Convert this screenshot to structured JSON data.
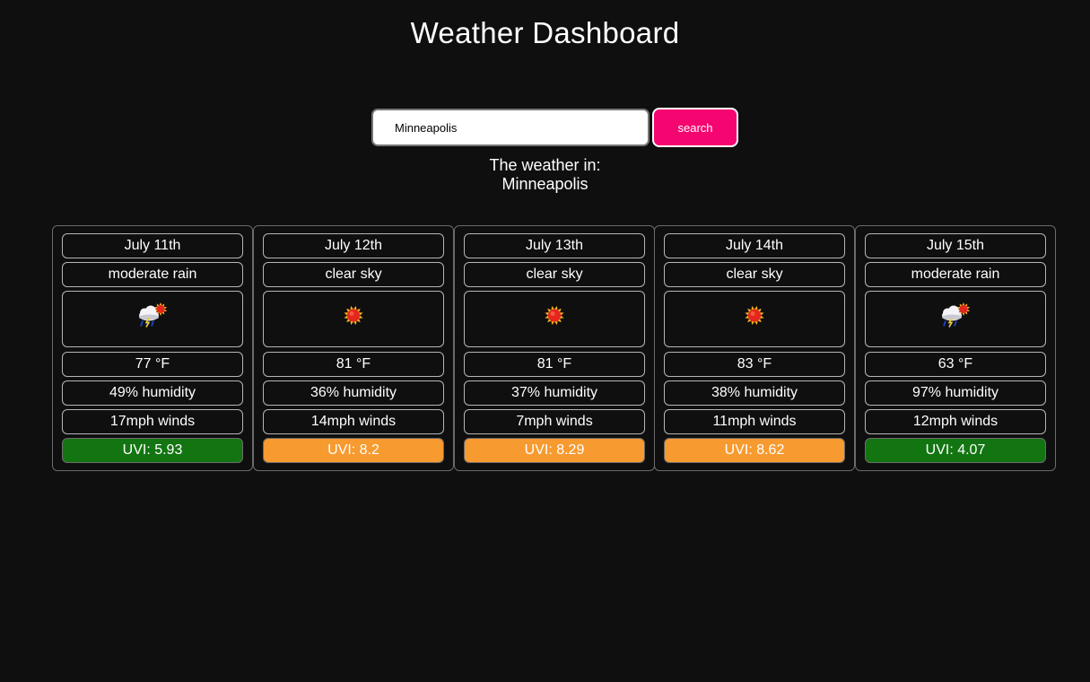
{
  "header": {
    "title": "Weather Dashboard"
  },
  "search": {
    "value": "Minneapolis",
    "button_label": "search"
  },
  "location": {
    "label": "The weather in:",
    "city": "Minneapolis"
  },
  "colors": {
    "background": "#0f0f0f",
    "search_button": "#f5056f",
    "uvi_moderate": "#137512",
    "uvi_high": "#f79a2f"
  },
  "forecast": [
    {
      "date": "July 11th",
      "description": "moderate rain",
      "icon": "rain-sun-icon",
      "temp": "77 °F",
      "humidity": "49% humidity",
      "wind": "17mph winds",
      "uvi": "UVI: 5.93",
      "uvi_level": "moderate"
    },
    {
      "date": "July 12th",
      "description": "clear sky",
      "icon": "sun-icon",
      "temp": "81 °F",
      "humidity": "36% humidity",
      "wind": "14mph winds",
      "uvi": "UVI: 8.2",
      "uvi_level": "high"
    },
    {
      "date": "July 13th",
      "description": "clear sky",
      "icon": "sun-icon",
      "temp": "81 °F",
      "humidity": "37% humidity",
      "wind": "7mph winds",
      "uvi": "UVI: 8.29",
      "uvi_level": "high"
    },
    {
      "date": "July 14th",
      "description": "clear sky",
      "icon": "sun-icon",
      "temp": "83 °F",
      "humidity": "38% humidity",
      "wind": "11mph winds",
      "uvi": "UVI: 8.62",
      "uvi_level": "high"
    },
    {
      "date": "July 15th",
      "description": "moderate rain",
      "icon": "rain-sun-icon",
      "temp": "63 °F",
      "humidity": "97% humidity",
      "wind": "12mph winds",
      "uvi": "UVI: 4.07",
      "uvi_level": "moderate"
    }
  ]
}
